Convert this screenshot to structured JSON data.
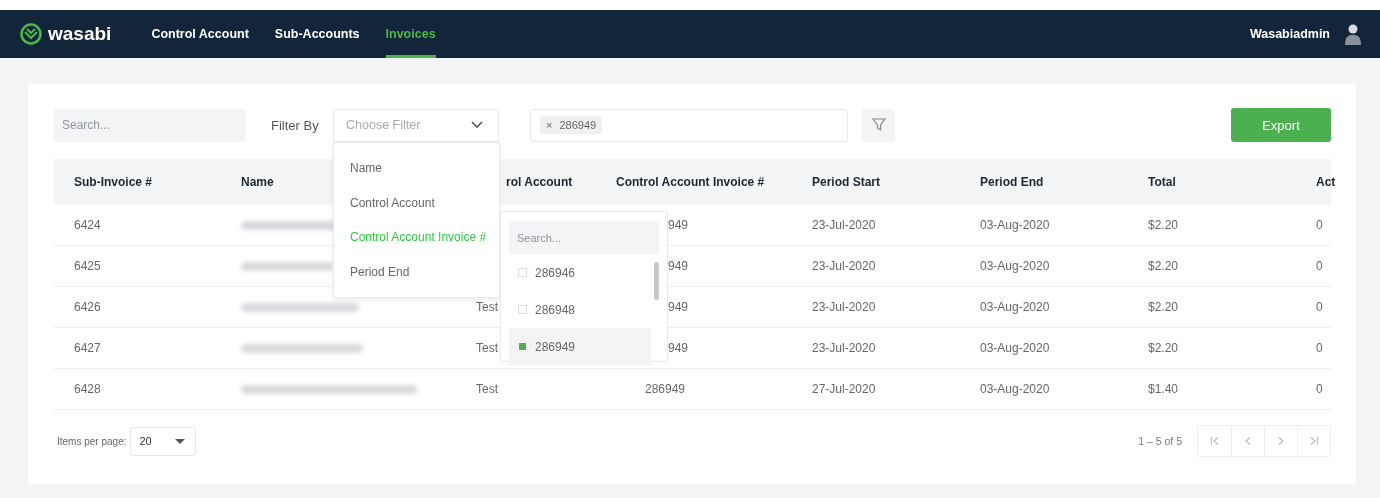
{
  "navbar": {
    "logo": "wasabi",
    "tabs": [
      {
        "label": "Control Account",
        "selected": false
      },
      {
        "label": "Sub-Accounts",
        "selected": false
      },
      {
        "label": "Invoices",
        "selected": true
      }
    ],
    "user": "Wasabiadmin"
  },
  "toolbar": {
    "search": {
      "placeholder": "Search..."
    },
    "filter_label": "Filter By",
    "filter_select": {
      "placeholder": "Choose Filter"
    },
    "chips": [
      {
        "label": "286949"
      }
    ],
    "chip_remove": "×",
    "export": "Export"
  },
  "table": {
    "columns": [
      {
        "label": "Sub-Invoice #"
      },
      {
        "label": "Name"
      },
      {
        "label": "rol Account"
      },
      {
        "label": "Control Account Invoice #"
      },
      {
        "label": "Period Start"
      },
      {
        "label": "Period End"
      },
      {
        "label": "Total"
      },
      {
        "label": "Act"
      }
    ],
    "rows": [
      {
        "sub_invoice": "6424",
        "name_blurred": true,
        "invoice": "949",
        "invoice_partial": true,
        "period_start": "23-Jul-2020",
        "period_end": "03-Aug-2020",
        "total": "$2.20",
        "column_8": "0"
      },
      {
        "sub_invoice": "6425",
        "name_blurred": true,
        "invoice": "949",
        "invoice_partial": true,
        "period_start": "23-Jul-2020",
        "period_end": "03-Aug-2020",
        "total": "$2.20",
        "column_8": "0"
      },
      {
        "sub_invoice": "6426",
        "name_blurred": true,
        "control_account": "Test",
        "invoice": "949",
        "invoice_partial": true,
        "period_start": "23-Jul-2020",
        "period_end": "03-Aug-2020",
        "total": "$2.20",
        "column_8": "0"
      },
      {
        "sub_invoice": "6427",
        "name_blurred": true,
        "control_account": "Test",
        "invoice": "949",
        "invoice_partial": true,
        "period_start": "23-Jul-2020",
        "period_end": "03-Aug-2020",
        "total": "$2.20",
        "column_8": "0"
      },
      {
        "sub_invoice": "6428",
        "name_blurred": true,
        "control_account": "Test",
        "invoice": "286949",
        "invoice_partial": false,
        "period_start": "27-Jul-2020",
        "period_end": "03-Aug-2020",
        "total": "$1.40",
        "column_8": "0"
      }
    ]
  },
  "filter_menu": {
    "items": [
      {
        "label": "Name",
        "selected": false
      },
      {
        "label": "Control Account",
        "selected": false
      },
      {
        "label": "Control Account Invoice #",
        "selected": true
      },
      {
        "label": "Period End",
        "selected": false
      }
    ]
  },
  "value_menu": {
    "search": {
      "placeholder": "Search..."
    },
    "items": [
      {
        "label": "286946",
        "checked": false,
        "selected": false
      },
      {
        "label": "286948",
        "checked": false,
        "selected": false
      },
      {
        "label": "286949",
        "checked": true,
        "selected": true
      }
    ]
  },
  "footer": {
    "items_per_page_label": "Items per page:",
    "items_per_page": "20",
    "range": "1 – 5 of 5"
  }
}
